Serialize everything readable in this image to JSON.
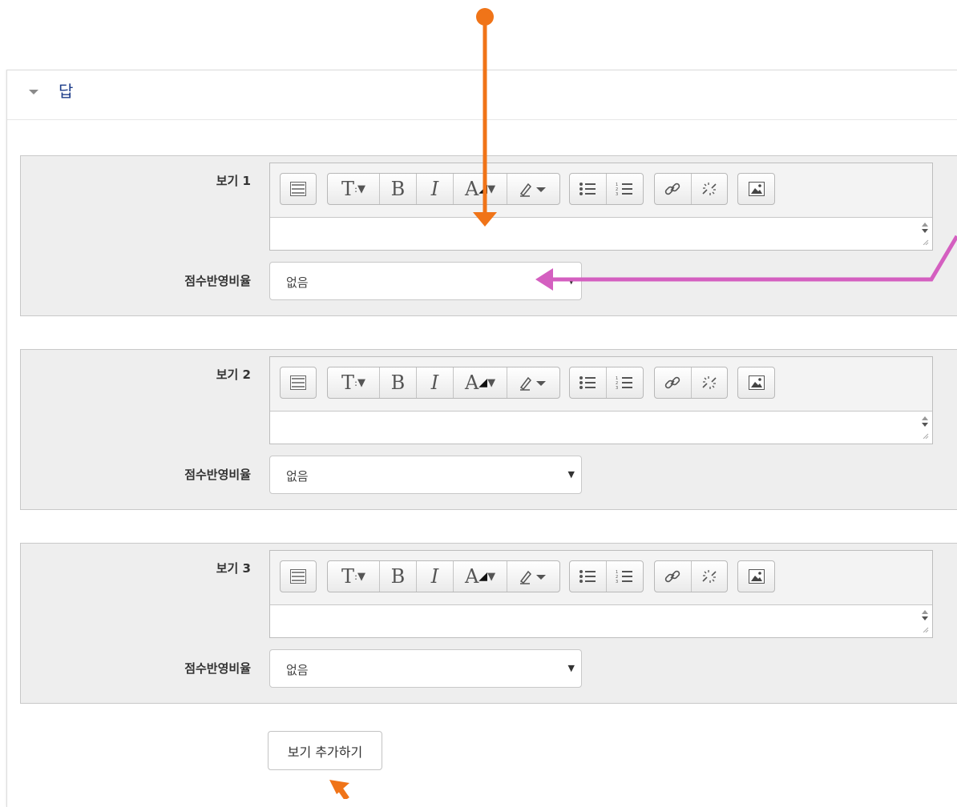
{
  "section": {
    "title": "답",
    "collapse_icon": "chevron-down-icon"
  },
  "choices": [
    {
      "label": "보기 1",
      "grade_label": "점수반영비율",
      "grade_value": "없음"
    },
    {
      "label": "보기 2",
      "grade_label": "점수반영비율",
      "grade_value": "없음"
    },
    {
      "label": "보기 3",
      "grade_label": "점수반영비율",
      "grade_value": "없음"
    }
  ],
  "toolbar": {
    "icons": [
      "toolbar-toggle-icon",
      "font-size-icon",
      "bold-icon",
      "italic-icon",
      "font-color-icon",
      "highlight-icon",
      "bulleted-list-icon",
      "numbered-list-icon",
      "link-icon",
      "unlink-icon",
      "image-icon"
    ],
    "bold": "B",
    "italic": "I"
  },
  "add_button": {
    "label": "보기 추가하기"
  },
  "colors": {
    "section_title": "#1d3d8a",
    "box_background": "#eeeeee",
    "annotation_orange": "#f07418",
    "annotation_magenta": "#d45fc0"
  }
}
